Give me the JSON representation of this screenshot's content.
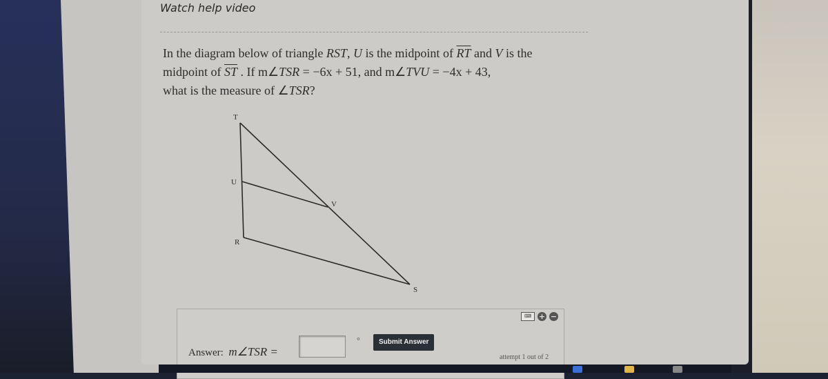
{
  "help": {
    "label": "Watch help video"
  },
  "question": {
    "line1_pre": "In the diagram below of triangle ",
    "triangle": "RST",
    "line1_mid": ", ",
    "u": "U",
    "line1_mid2": " is the midpoint of ",
    "seg1": "RT",
    "line1_mid3": " and ",
    "v": "V",
    "line1_post": " is the",
    "line2_pre": "midpoint of ",
    "seg2": "ST",
    "line2_mid": " . If m∠",
    "angle1": "TSR",
    "eq1": " = −6x + 51, and m∠",
    "angle2": "TVU",
    "eq2": " = −4x + 43,",
    "line3_pre": "what is the measure of ∠",
    "angle3": "TSR",
    "line3_post": "?"
  },
  "diagram": {
    "labels": {
      "T": "T",
      "U": "U",
      "V": "V",
      "R": "R",
      "S": "S"
    }
  },
  "answer": {
    "label_prefix": "Answer:",
    "expr": "m∠TSR =",
    "input_value": "",
    "degree": "°",
    "submit_label": "Submit Answer",
    "attempt": "attempt 1 out of 2"
  },
  "tools": {
    "keyboard": "keyboard-icon",
    "zoom_in": "+",
    "zoom_out": "−"
  }
}
